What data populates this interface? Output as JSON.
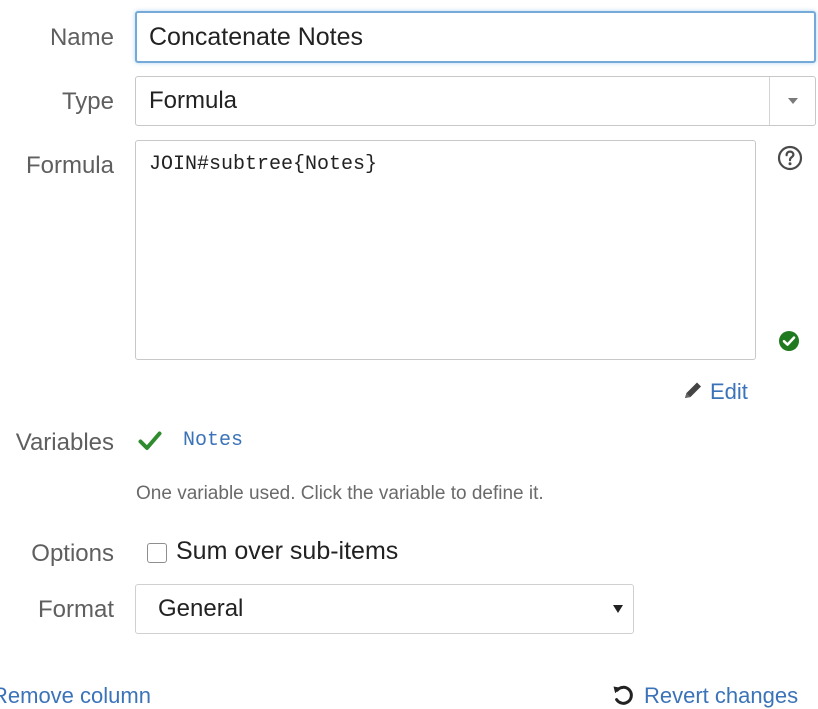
{
  "labels": {
    "name": "Name",
    "type": "Type",
    "formula": "Formula",
    "variables": "Variables",
    "options": "Options",
    "format": "Format"
  },
  "name_field": {
    "value": "Concatenate Notes"
  },
  "type_select": {
    "value": "Formula"
  },
  "formula_field": {
    "value": "JOIN#subtree{Notes}"
  },
  "icons": {
    "help": "question-circle-icon",
    "valid": "check-circle-icon",
    "edit": "pencil-icon",
    "variable_ok": "checkmark-icon",
    "revert": "undo-icon"
  },
  "edit_link": "Edit",
  "variables": {
    "items": [
      "Notes"
    ],
    "help_text": "One variable used. Click the variable to define it."
  },
  "options": {
    "sum_over_subitems": {
      "label": "Sum over sub-items",
      "checked": false
    }
  },
  "format_select": {
    "value": "General"
  },
  "footer": {
    "remove": "Remove column",
    "revert": "Revert changes"
  },
  "colors": {
    "link": "#3b73b9",
    "valid_green": "#1f7a1f",
    "check_green": "#2e8b2e",
    "focus_border": "#74a9d8",
    "label": "#5f5f5f"
  }
}
